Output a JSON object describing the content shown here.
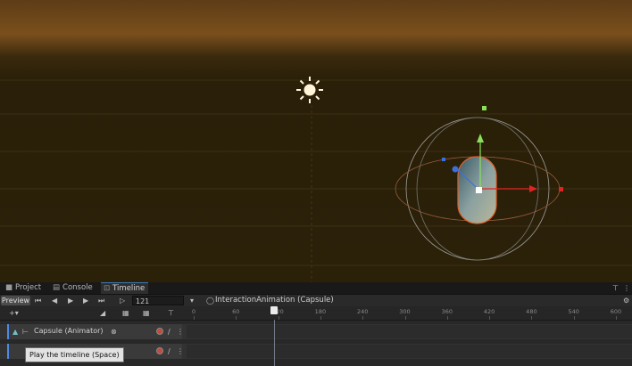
{
  "tabs": [
    {
      "label": "Project",
      "icon": "folder-icon"
    },
    {
      "label": "Console",
      "icon": "console-icon"
    },
    {
      "label": "Timeline",
      "icon": "timeline-icon"
    }
  ],
  "toolbar": {
    "preview_label": "Preview",
    "frame_value": "121",
    "asset_label": "InteractionAnimation (Capsule)"
  },
  "ruler": {
    "ticks": [
      "0",
      "60",
      "120",
      "180",
      "240",
      "300",
      "360",
      "420",
      "480",
      "540",
      "600"
    ],
    "playhead_frame": 121
  },
  "tracks": [
    {
      "label": "Capsule (Animator)"
    },
    {
      "label": ""
    }
  ],
  "tooltip": "Play the timeline (Space)",
  "colors": {
    "sky_top": "#7a4a18",
    "ground": "#2b2109",
    "gizmo_red": "#e02424",
    "gizmo_green": "#8be05a",
    "gizmo_blue": "#3a6fe0",
    "selection_orange": "#e0612a",
    "accent_blue": "#3a79bb"
  }
}
